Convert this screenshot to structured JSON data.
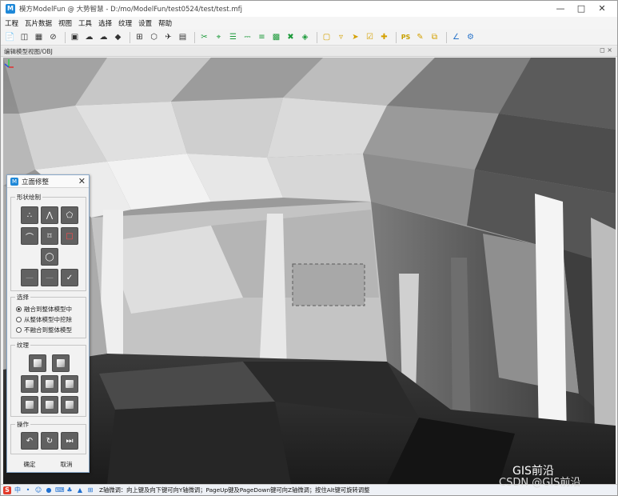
{
  "window": {
    "title": "模方ModelFun @ 大势智慧 - D:/mo/ModelFun/test0524/test/test.mfj"
  },
  "menu": [
    "工程",
    "瓦片数据",
    "视图",
    "工具",
    "选择",
    "纹理",
    "设置",
    "帮助"
  ],
  "toolbar": {
    "ps_label": "PS"
  },
  "viewport": {
    "title": "编辑模型视图/OBJ",
    "controls": "◻ ×"
  },
  "dialog": {
    "title": "立面修整",
    "groups": {
      "shape": "形状绘制",
      "select": "选择",
      "texture": "纹理",
      "operate": "操作"
    },
    "radios": [
      "融合到整体模型中",
      "从整体模型中挖除",
      "不融合到整体模型"
    ],
    "ok": "确定",
    "cancel": "取消"
  },
  "status": {
    "text": "Z轴微调：向上键及向下键可向Y轴微调；PageUp键及PageDown键可向Z轴微调；按住Alt键可旋转调整"
  },
  "watermark": {
    "line1": "GIS前沿",
    "line2": "CSDN @GIS前沿"
  }
}
